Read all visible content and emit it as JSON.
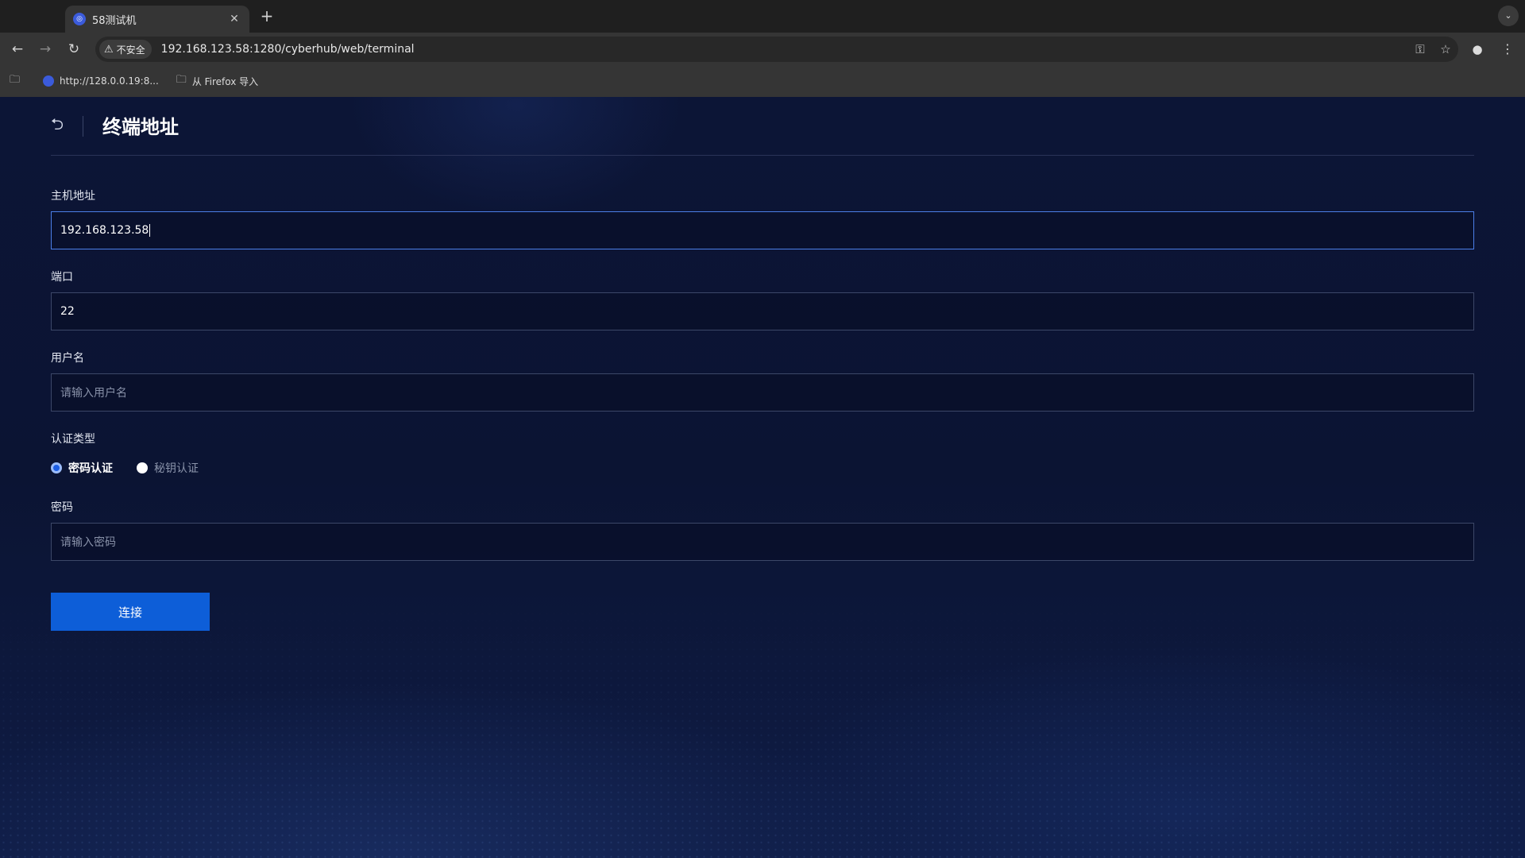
{
  "browser": {
    "tab_title": "58测试机",
    "new_tab": "+",
    "security_label": "不安全",
    "url": "192.168.123.58:1280/cyberhub/web/terminal",
    "bookmarks": [
      {
        "label": "http://128.0.0.19:8..."
      },
      {
        "label": "从 Firefox 导入"
      }
    ]
  },
  "page": {
    "title": "终端地址"
  },
  "form": {
    "host_label": "主机地址",
    "host_value": "192.168.123.58",
    "port_label": "端口",
    "port_value": "22",
    "username_label": "用户名",
    "username_placeholder": "请输入用户名",
    "auth_type_label": "认证类型",
    "auth_options": [
      {
        "label": "密码认证",
        "checked": true
      },
      {
        "label": "秘钥认证",
        "checked": false
      }
    ],
    "password_label": "密码",
    "password_placeholder": "请输入密码",
    "connect_label": "连接"
  },
  "colors": {
    "primary": "#0d5ed8",
    "background": "#0c1536"
  }
}
